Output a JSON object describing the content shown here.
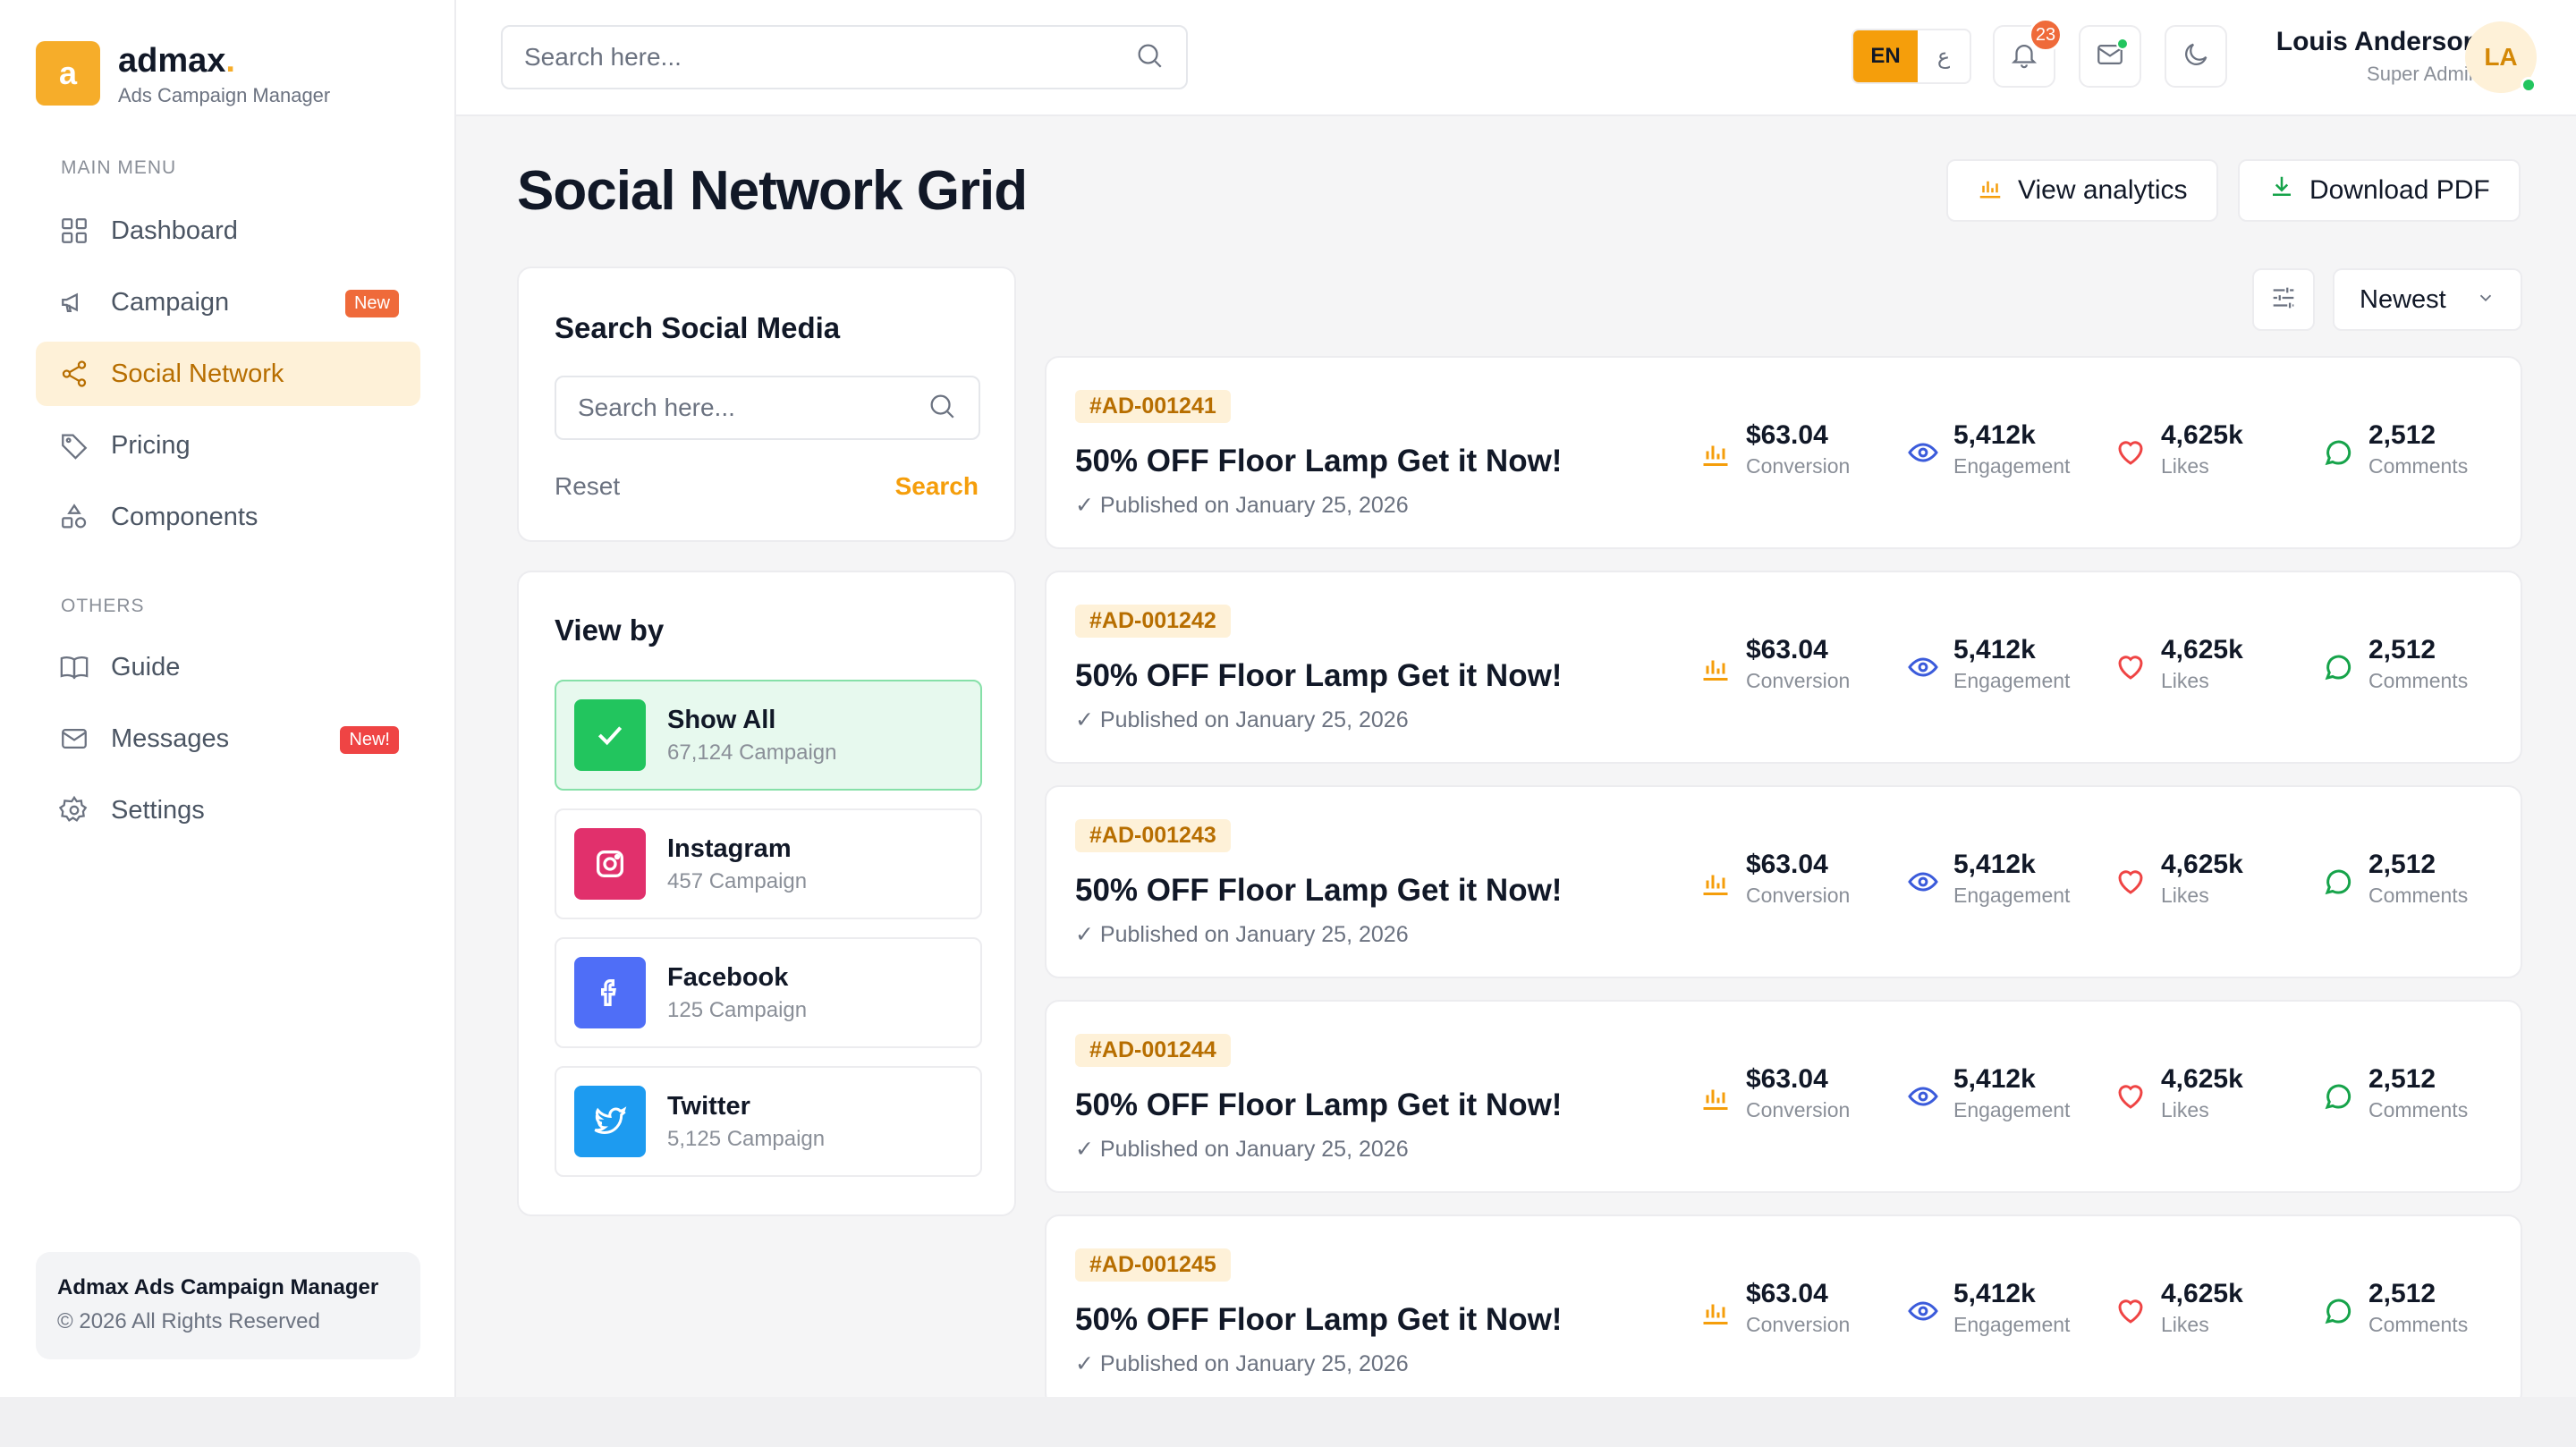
{
  "brand": {
    "initial": "a",
    "name": "admax",
    "dot": ".",
    "subtitle": "Ads Campaign Manager"
  },
  "sidebar": {
    "main_menu_title": "MAIN MENU",
    "others_title": "OTHERS",
    "main_items": [
      {
        "label": "Dashboard",
        "icon": "grid-icon"
      },
      {
        "label": "Campaign",
        "icon": "megaphone-icon",
        "badge": "New"
      },
      {
        "label": "Social Network",
        "icon": "share-icon",
        "active": true
      },
      {
        "label": "Pricing",
        "icon": "tag-icon"
      },
      {
        "label": "Components",
        "icon": "shapes-icon"
      }
    ],
    "other_items": [
      {
        "label": "Guide",
        "icon": "book-icon"
      },
      {
        "label": "Messages",
        "icon": "mail-icon",
        "badge": "New!"
      },
      {
        "label": "Settings",
        "icon": "gear-icon"
      }
    ],
    "footer": {
      "title": "Admax Ads Campaign Manager",
      "copyright": "© 2026 All Rights Reserved"
    }
  },
  "topbar": {
    "search_placeholder": "Search here...",
    "lang_active": "EN",
    "lang_other": "ع",
    "notifications_count": "23",
    "user": {
      "name": "Louis Anderson",
      "role": "Super Admin",
      "initials": "LA"
    }
  },
  "page": {
    "title": "Social Network Grid",
    "view_analytics": "View analytics",
    "download_pdf": "Download PDF",
    "sort_label": "Newest"
  },
  "search_panel": {
    "title": "Search Social Media",
    "placeholder": "Search here...",
    "reset": "Reset",
    "search": "Search"
  },
  "view_by": {
    "title": "View by",
    "items": [
      {
        "name": "Show All",
        "count": "67,124 Campaign",
        "icon": "check-icon",
        "color": "#22c55e"
      },
      {
        "name": "Instagram",
        "count": "457 Campaign",
        "icon": "instagram-icon",
        "color": "#e1306c"
      },
      {
        "name": "Facebook",
        "count": "125 Campaign",
        "icon": "facebook-icon",
        "color": "#4f6ef7"
      },
      {
        "name": "Twitter",
        "count": "5,125 Campaign",
        "icon": "twitter-icon",
        "color": "#1d9bf0"
      }
    ]
  },
  "ads": [
    {
      "id": "#AD-001241",
      "title": "50% OFF Floor Lamp Get it Now!",
      "published": "✓ Published on January 25, 2026",
      "conversion": "$63.04",
      "engagement": "5,412k",
      "likes": "4,625k",
      "comments": "2,512"
    },
    {
      "id": "#AD-001242",
      "title": "50% OFF Floor Lamp Get it Now!",
      "published": "✓ Published on January 25, 2026",
      "conversion": "$63.04",
      "engagement": "5,412k",
      "likes": "4,625k",
      "comments": "2,512"
    },
    {
      "id": "#AD-001243",
      "title": "50% OFF Floor Lamp Get it Now!",
      "published": "✓ Published on January 25, 2026",
      "conversion": "$63.04",
      "engagement": "5,412k",
      "likes": "4,625k",
      "comments": "2,512"
    },
    {
      "id": "#AD-001244",
      "title": "50% OFF Floor Lamp Get it Now!",
      "published": "✓ Published on January 25, 2026",
      "conversion": "$63.04",
      "engagement": "5,412k",
      "likes": "4,625k",
      "comments": "2,512"
    },
    {
      "id": "#AD-001245",
      "title": "50% OFF Floor Lamp Get it Now!",
      "published": "✓ Published on January 25, 2026",
      "conversion": "$63.04",
      "engagement": "5,412k",
      "likes": "4,625k",
      "comments": "2,512"
    }
  ],
  "stat_labels": {
    "conversion": "Conversion",
    "engagement": "Engagement",
    "likes": "Likes",
    "comments": "Comments"
  },
  "colors": {
    "accent": "#f59e0b",
    "accent_soft": "#fef1d8",
    "badge": "#ef6a3a",
    "online": "#22c55e",
    "eye": "#3b5bdb",
    "heart": "#ef4444",
    "comment": "#16a34a"
  }
}
